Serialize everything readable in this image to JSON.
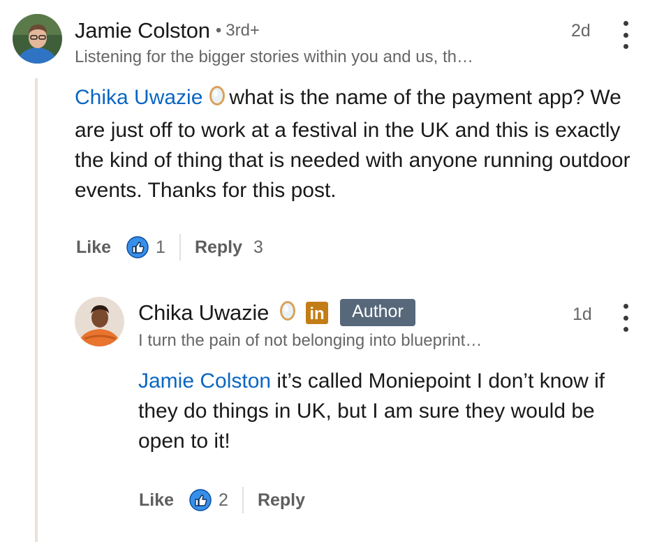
{
  "colors": {
    "mention": "#0a66c2",
    "secondary_text": "#666666",
    "author_badge_bg": "#56687a",
    "thread_line": "#e9e2dc",
    "linkedin_premium": "#c37d16"
  },
  "comment": {
    "author": "Jamie Colston",
    "separator": "•",
    "degree": "3rd+",
    "headline": "Listening for the bigger stories within you and us, th…",
    "timestamp": "2d",
    "mention": "Chika Uwazie",
    "mention_icon": "mirror-icon",
    "text": "what is the name of the payment app? We are just off to work at a festival in the UK and this is exactly the kind of thing that is needed with anyone running outdoor events. Thanks for this post.",
    "like_label": "Like",
    "reaction_icon": "like-reaction-icon",
    "like_count": "1",
    "reply_label": "Reply",
    "reply_count": "3",
    "more_icon": "more-vertical-icon"
  },
  "reply": {
    "author": "Chika Uwazie",
    "name_icons": [
      "mirror-icon",
      "linkedin-icon"
    ],
    "linkedin_glyph": "in",
    "badge": "Author",
    "headline": "I turn the pain of not belonging into blueprint…",
    "timestamp": "1d",
    "mention": "Jamie Colston",
    "text": "it’s called Moniepoint I don’t know if they do things in UK, but I am sure they would be open to it!",
    "like_label": "Like",
    "reaction_icon": "like-reaction-icon",
    "like_count": "2",
    "reply_label": "Reply",
    "more_icon": "more-vertical-icon"
  }
}
